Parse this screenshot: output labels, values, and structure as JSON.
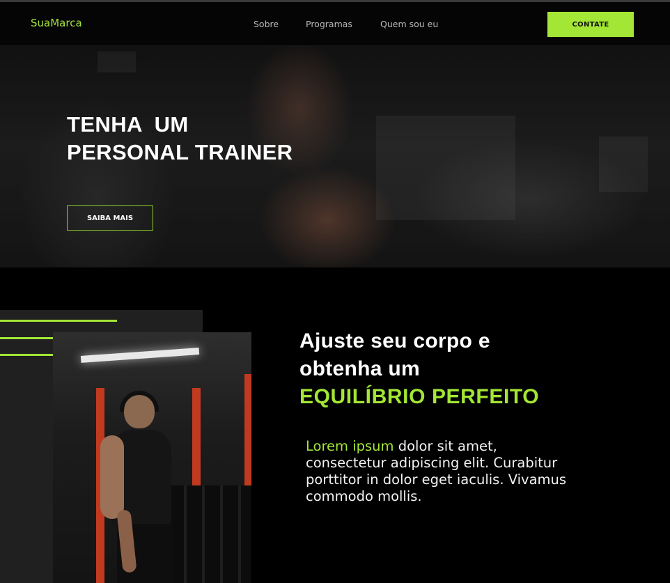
{
  "navbar": {
    "brand": "SuaMarca",
    "links": [
      "Sobre",
      "Programas",
      "Quem sou eu"
    ],
    "cta_label": "CONTATE"
  },
  "hero": {
    "title_line1": "TENHA  UM",
    "title_line2": "PERSONAL TRAINER",
    "button_label": "SAIBA MAIS"
  },
  "about": {
    "heading_line1": "Ajuste seu corpo e",
    "heading_line2": "obtenha um",
    "heading_accent": "EQUILÍBRIO PERFEITO",
    "paragraph_lead": "Lorem ipsum",
    "paragraph_rest": " dolor sit amet, consectetur adipiscing elit. Curabitur porttitor in dolor eget iaculis. Vivamus commodo mollis."
  },
  "colors": {
    "accent": "#a3e635",
    "background": "#000000",
    "panel": "#202020"
  },
  "icons": []
}
